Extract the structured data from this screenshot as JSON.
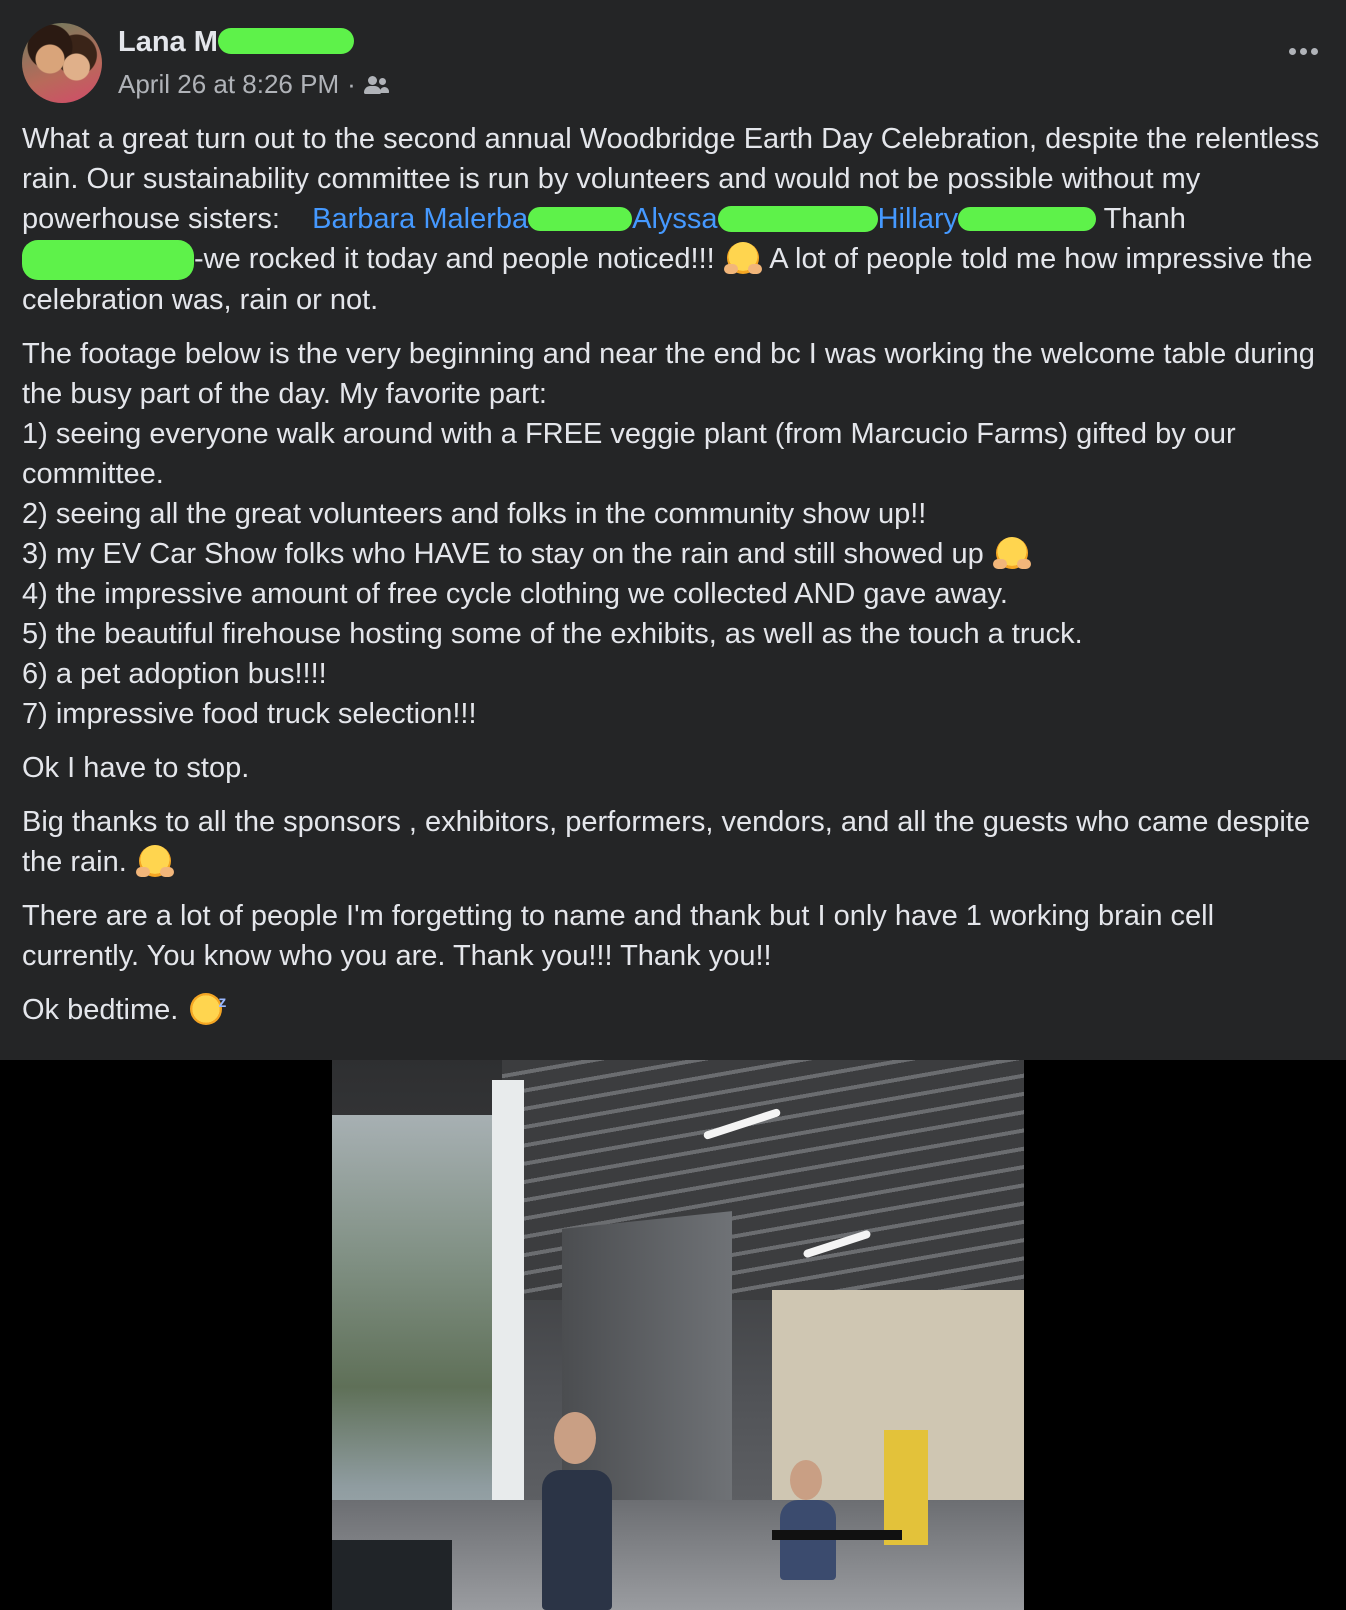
{
  "post": {
    "author": "Lana M",
    "timestamp": "April 26 at 8:26 PM",
    "separator": "·",
    "audience_icon": "friends-icon",
    "more_icon": "more-options-icon",
    "paragraphs": {
      "p1_a": "What a great turn out to the second annual Woodbridge Earth Day Celebration, despite the relentless rain. Our sustainability committee is run by volunteers and would not be possible without my powerhouse sisters:",
      "mention1": "Barbara Malerba",
      "mention2": "Alyssa",
      "mention3": "Hillary",
      "p1_thanh": "Thanh",
      "p1_b": "-we rocked it today and people noticed!!!",
      "p1_c": "A lot of people told me how impressive the celebration was, rain or not.",
      "p2_intro": "The footage below is the very beginning and near the end bc I was working the welcome table during the busy part of the day.  My favorite part:",
      "item1": "1) seeing everyone walk around with a FREE veggie plant (from Marcucio Farms) gifted by our committee.",
      "item2": "2) seeing all the great volunteers and folks in the community show up!!",
      "item3": "3) my EV Car Show folks who HAVE to stay on the rain and still showed up",
      "item4": "4) the impressive amount of free cycle clothing we collected AND gave away.",
      "item5": "5) the beautiful firehouse hosting some of the exhibits, as well as the touch a truck.",
      "item6": "6) a pet adoption bus!!!!",
      "item7": "7) impressive food truck selection!!!",
      "p3": "Ok I have to stop.",
      "p4": "Big thanks to all the sponsors , exhibitors, performers, vendors, and all the guests who came despite the rain.",
      "p5": "There are a lot of people I'm forgetting to name and thank but I only have 1 working brain cell currently.   You know who you are.  Thank you!!!   Thank you!!",
      "p6": "Ok bedtime."
    },
    "colors": {
      "background": "#242526",
      "text": "#e4e6eb",
      "secondary_text": "#b0b3b8",
      "mention": "#4599ff",
      "redaction": "#5ef24a"
    }
  }
}
